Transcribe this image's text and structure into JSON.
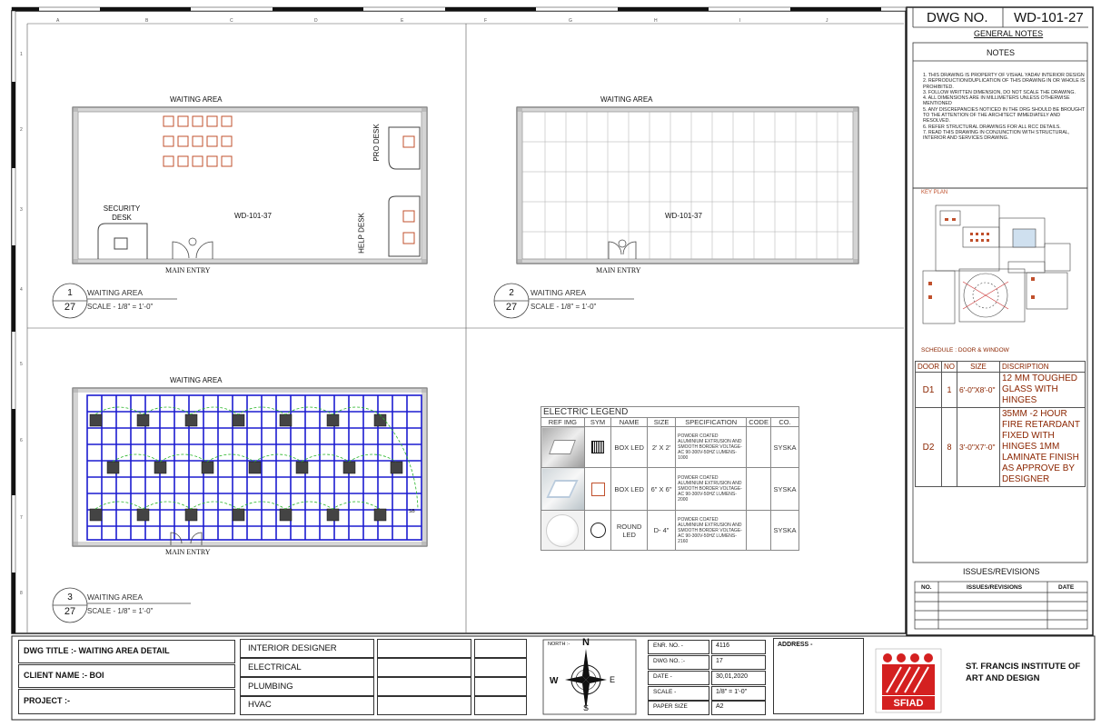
{
  "grid_letters": [
    "A",
    "B",
    "C",
    "D",
    "E",
    "F",
    "G",
    "H",
    "I",
    "J"
  ],
  "grid_numbers": [
    "1",
    "2",
    "3",
    "4",
    "5",
    "6",
    "7",
    "8"
  ],
  "plan1": {
    "top_label": "WAITING AREA",
    "room_code": "WD-101-37",
    "security": "SECURITY DESK",
    "pro": "PRO DESK",
    "help": "HELP DESK",
    "entry": "MAIN ENTRY",
    "num": "1",
    "den": "27",
    "title": "WAITING AREA",
    "scale": "SCALE - 1/8\" = 1'-0\""
  },
  "plan2": {
    "top_label": "WAITING AREA",
    "room_code": "WD-101-37",
    "entry": "MAIN ENTRY",
    "num": "2",
    "den": "27",
    "title": "WAITING AREA",
    "scale": "SCALE - 1/8\" = 1'-0\""
  },
  "plan3": {
    "top_label": "WAITING AREA",
    "entry": "MAIN ENTRY",
    "tag": "SB",
    "num": "3",
    "den": "27",
    "title": "WAITING AREA",
    "scale": "SCALE - 1/8\" = 1'-0\""
  },
  "legend": {
    "title": "ELECTRIC LEGEND",
    "headers": [
      "REF IMG",
      "SYM",
      "NAME",
      "SIZE",
      "SPECIFICATION",
      "CODE",
      "CO."
    ],
    "rows": [
      {
        "name": "BOX LED",
        "size": "2' X 2'",
        "spec": "POWDER COATED ALUMINIUM EXTRUSION AND SMOOTH BORDER VOLTAGE- AC 90-300V-50HZ LUMENS-1000",
        "code": "",
        "co": "SYSKA"
      },
      {
        "name": "BOX LED",
        "size": "6\" X 6\"",
        "spec": "POWDER COATED ALUMINIUM EXTRUSION AND SMOOTH BORDER VOLTAGE- AC 90-300V-50HZ LUMENS-2000",
        "code": "",
        "co": "SYSKA"
      },
      {
        "name": "ROUND LED",
        "size": "D- 4\"",
        "spec": "POWDER COATED ALUMINIUM EXTRUSION AND SMOOTH BORDER VOLTAGE- AC 90-300V-50HZ LUMENS-2160",
        "code": "",
        "co": "SYSKA"
      }
    ]
  },
  "panel": {
    "dwg_no_label": "DWG NO.",
    "dwg_no_value": "WD-101-27",
    "general_notes": "GENERAL NOTES",
    "notes_title": "NOTES",
    "notes": [
      "1.  THIS DRAWING IS PROPERTY OF VISHAL YADAV INTERIOR DESIGN",
      "2.  REPRODUCTION/DUPLICATION OF THIS DRAWING IN OR WHOLE IS PROHIBITED.",
      "3.  FOLLOW WRITTEN DIMENSION, DO NOT SCALE THE DRAWING.",
      "4.  ALL DIMENSIONS ARE IN MILLIMETERS UNLESS OTHERWISE MENTIONED",
      "5.  ANY DISCREPANCIES NOTICED IN THE DRG SHOULD BE BROUGHT TO THE ATTENTION OF THE ARCHITECT IMMEDIATELY AND RESOLVED.",
      "6.  REFER STRUCTURAL DRAWINGS FOR ALL RCC DETAILS.",
      "7.  READ THIS DRAWING IN CONJUNCTION WITH STRUCTURAL, INTERIOR AND SERVICES DRAWING."
    ],
    "key_plan": "KEY PLAN",
    "schedule_title": "SCHEDULE :  DOOR & WINDOW",
    "schedule_headers": [
      "DOOR",
      "NO",
      "SIZE",
      "DISCRIPTION"
    ],
    "schedule_rows": [
      {
        "door": "D1",
        "no": "1",
        "size": "6'-0\"X8'-0\"",
        "desc": "12 MM TOUGHED GLASS WITH HINGES"
      },
      {
        "door": "D2",
        "no": "8",
        "size": "3'-0\"X7'-0\"",
        "desc": "35MM -2 HOUR FIRE RETARDANT FIXED WITH HINGES 1MM LAMINATE FINISH AS APPROVE BY DESIGNER"
      }
    ],
    "issues_title": "ISSUES/REVISIONS",
    "issues_headers": [
      "NO.",
      "ISSUES/REVISIONS",
      "DATE"
    ]
  },
  "title_block": {
    "dwg_title": "DWG TITLE :- WAITING AREA DETAIL",
    "client": "CLIENT NAME :- BOI",
    "project": "PROJECT :-",
    "disciplines": [
      "INTERIOR DESIGNER",
      "ELECTRICAL",
      "PLUMBING",
      "HVAC"
    ],
    "north_label": "NORTH :-",
    "compass": {
      "n": "N",
      "s": "S",
      "e": "E",
      "w": "W"
    },
    "info": [
      {
        "label": "ENR. NO. -",
        "value": "4116"
      },
      {
        "label": "DWG NO. :-",
        "value": "17"
      },
      {
        "label": "DATE -",
        "value": "30,01,2020"
      },
      {
        "label": "SCALE -",
        "value": "1/8\" = 1'-0\""
      },
      {
        "label": "PAPER SIZE",
        "value": "A2"
      }
    ],
    "address_label": "ADDRESS -",
    "logo_text": "SFIAD",
    "institute": "ST. FRANCIS INSTITUTE OF ART AND DESIGN"
  },
  "colors": {
    "furniture": "#c0502c",
    "brand_red": "#d42020",
    "grid_blue": "#1c1cd0",
    "circuit_green": "#26b526",
    "schedule_text": "#8b2500"
  }
}
